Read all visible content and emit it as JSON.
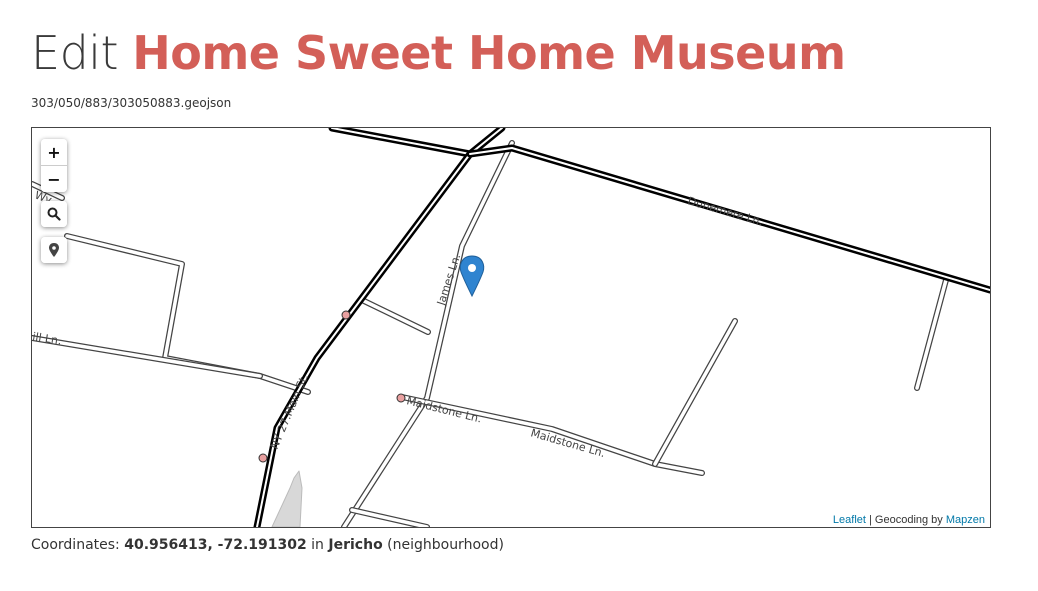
{
  "header": {
    "verb": "Edit",
    "place_name": "Home Sweet Home Museum",
    "file_path": "303/050/883/303050883.geojson"
  },
  "map": {
    "controls": {
      "zoom_in": "+",
      "zoom_out": "−",
      "search_icon": "search-icon",
      "locate_icon": "map-marker-icon"
    },
    "road_labels": [
      "Dunemere Ln.",
      "James Ln.",
      "NY 27.Main St.",
      "Maidstone Ln.",
      "Maidstone Ln.",
      "ill Ln.",
      "Wy"
    ],
    "marker": {
      "color": "#2f84d0",
      "icon": "map-pin-icon"
    },
    "attribution": {
      "leaflet": "Leaflet",
      "separator": " | Geocoding by ",
      "mapzen": "Mapzen"
    }
  },
  "coordinates": {
    "label": "Coordinates: ",
    "value": "40.956413, -72.191302",
    "in_text": " in ",
    "place": "Jericho",
    "place_type": " (neighbourhood)"
  },
  "colors": {
    "accent": "#d35f58",
    "link": "#0078a8",
    "marker": "#2f84d0"
  }
}
